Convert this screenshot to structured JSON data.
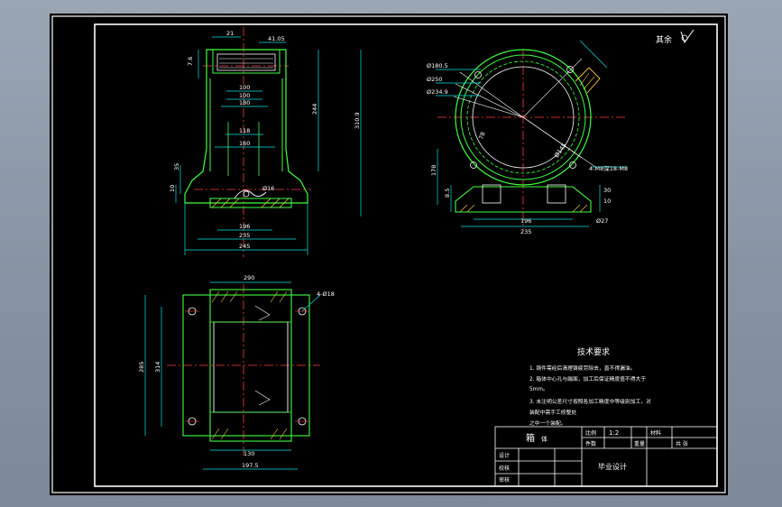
{
  "roughness_note": "其余",
  "tech": {
    "title": "技术要求",
    "lines": [
      "1. 铸件需经后清理铸疲劳除去，直不得漏油。",
      "2. 箱体中心孔与端面，加工后保证精度值不得大于",
      "   5mm。",
      "3. 未注明公差尺寸按照各加工精度中等级别加工，对",
      "   装配中需手工修整处",
      "   之中一个装配。"
    ]
  },
  "title_block": {
    "part_name": "箱",
    "part_note": "体",
    "scale_label": "比例",
    "scale_value": "1:2",
    "qty_label": "件数",
    "weight_label": "重量",
    "material_label": "材料",
    "sheet_label": "共 张",
    "design_label": "设计",
    "check_label": "校核",
    "review_label": "审核",
    "project": "毕业设计"
  },
  "dims": {
    "front": {
      "d21": "21",
      "d4105": "41.05",
      "d76": "7.6",
      "d100a": "100",
      "d100b": "100",
      "d180": "180",
      "d118": "118",
      "d160": "160",
      "d244": "244",
      "d3109": "310.9",
      "d35": "35",
      "d10": "10",
      "d16": "Ø16",
      "d196": "196",
      "d235": "235",
      "d245": "245"
    },
    "side": {
      "d1805": "Ø180.5",
      "d250": "Ø250",
      "d2349": "Ø234.9",
      "d78": "78",
      "d145": "Ø145",
      "holes": "4-M8深18-M8",
      "d178": "178",
      "d85": "8.5",
      "d30": "30",
      "d10": "10",
      "d196": "196",
      "d235": "235",
      "d27": "Ø27"
    },
    "top": {
      "d290": "290",
      "holes": "4-Ø18",
      "d285": "285",
      "d314": "314",
      "d130": "130",
      "d1975": "197.5"
    }
  }
}
